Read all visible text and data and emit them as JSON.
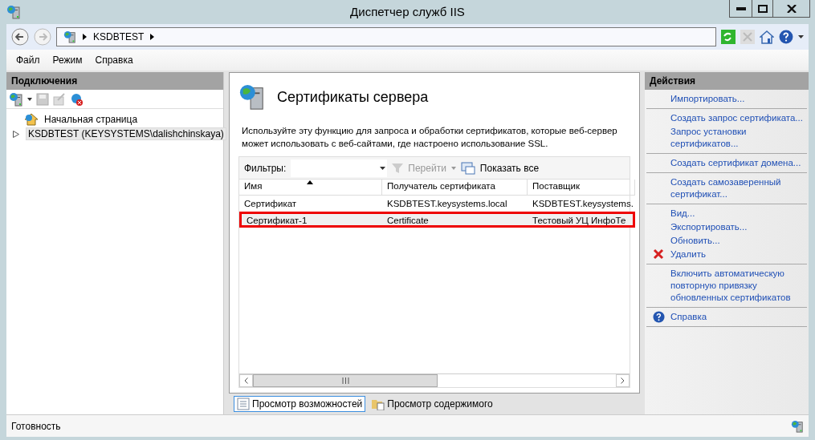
{
  "window": {
    "title": "Диспетчер служб IIS"
  },
  "address_bar": {
    "path": [
      {
        "label": "KSDBTEST"
      }
    ]
  },
  "menu": [
    {
      "label": "Файл"
    },
    {
      "label": "Режим"
    },
    {
      "label": "Справка"
    }
  ],
  "connections": {
    "title": "Подключения",
    "tree": [
      {
        "label": "Начальная страница",
        "kind": "home",
        "selected": false
      },
      {
        "label": "KSDBTEST (KEYSYSTEMS\\dalishchinskaya)",
        "kind": "server",
        "selected": true,
        "expanded": false
      }
    ]
  },
  "feature": {
    "title": "Сертификаты сервера",
    "description": "Используйте эту функцию для запроса и обработки сертификатов, которые веб-сервер может использовать с веб-сайтами, где настроено использование SSL.",
    "filter": {
      "label": "Фильтры:",
      "go": {
        "label": "Перейти",
        "disabled": true
      },
      "show_all": {
        "label": "Показать все"
      }
    },
    "table": {
      "columns": [
        {
          "label": "Имя",
          "sorted": true
        },
        {
          "label": "Получатель сертификата",
          "sorted": false
        },
        {
          "label": "Поставщик",
          "sorted": false
        }
      ],
      "rows": [
        {
          "cells": [
            "Сертификат",
            "KSDBTEST.keysystems.local",
            "KSDBTEST.keysystems."
          ],
          "selected": false,
          "highlighted": false
        },
        {
          "cells": [
            "Сертификат-1",
            "Certificate",
            "Тестовый УЦ ИнфоТе"
          ],
          "selected": true,
          "highlighted": true
        }
      ]
    }
  },
  "view_tabs": [
    {
      "label": "Просмотр возможностей",
      "kind": "features",
      "selected": true
    },
    {
      "label": "Просмотр содержимого",
      "kind": "content",
      "selected": false
    }
  ],
  "actions": {
    "title": "Действия",
    "groups": [
      [
        {
          "label": "Импортировать...",
          "kind": "link"
        }
      ],
      [
        {
          "label": "Создать запрос сертификата...",
          "kind": "link"
        },
        {
          "label": "Запрос установки сертификатов...",
          "kind": "link"
        }
      ],
      [
        {
          "label": "Создать сертификат домена...",
          "kind": "link"
        }
      ],
      [
        {
          "label": "Создать самозаверенный сертификат...",
          "kind": "link"
        }
      ],
      [
        {
          "label": "Вид...",
          "kind": "link"
        },
        {
          "label": "Экспортировать...",
          "kind": "link"
        },
        {
          "label": "Обновить...",
          "kind": "link"
        },
        {
          "label": "Удалить",
          "kind": "delete"
        }
      ],
      [
        {
          "label": "Включить автоматическую повторную привязку обновленных сертификатов",
          "kind": "link"
        }
      ],
      [
        {
          "label": "Справка",
          "kind": "help"
        }
      ]
    ]
  },
  "status_bar": {
    "text": "Готовность"
  }
}
